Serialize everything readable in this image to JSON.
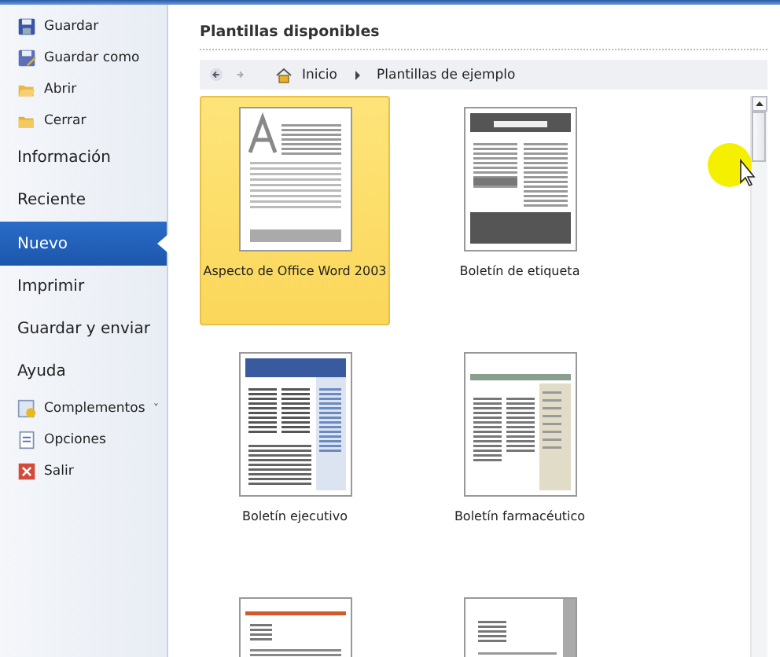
{
  "sidebar": {
    "items": [
      {
        "kind": "command",
        "label": "Guardar",
        "selected": false
      },
      {
        "kind": "command",
        "label": "Guardar como",
        "selected": false
      },
      {
        "kind": "command",
        "label": "Abrir",
        "selected": false
      },
      {
        "kind": "command",
        "label": "Cerrar",
        "selected": false
      },
      {
        "kind": "section",
        "label": "Información",
        "selected": false
      },
      {
        "kind": "section",
        "label": "Reciente",
        "selected": false
      },
      {
        "kind": "section",
        "label": "Nuevo",
        "selected": true
      },
      {
        "kind": "section",
        "label": "Imprimir",
        "selected": false
      },
      {
        "kind": "section",
        "label": "Guardar y enviar",
        "selected": false
      },
      {
        "kind": "section",
        "label": "Ayuda",
        "selected": false
      },
      {
        "kind": "command",
        "label": "Complementos",
        "dropdown": "ˇ",
        "selected": false
      },
      {
        "kind": "command",
        "label": "Opciones",
        "selected": false
      },
      {
        "kind": "command",
        "label": "Salir",
        "selected": false
      }
    ]
  },
  "main": {
    "title": "Plantillas disponibles",
    "breadcrumb": [
      "Inicio",
      "Plantillas de ejemplo"
    ],
    "templates": [
      {
        "kind": "classic",
        "label": "Aspecto de Office Word 2003",
        "selected": true
      },
      {
        "kind": "dark-newsletter",
        "label": "Boletín de etiqueta",
        "selected": false
      },
      {
        "kind": "blue-newsletter",
        "label": "Boletín ejecutivo",
        "selected": false
      },
      {
        "kind": "green-newsletter",
        "label": "Boletín farmacéutico",
        "selected": false
      },
      {
        "kind": "orange-letter",
        "selected": false
      },
      {
        "kind": "plain-letter",
        "selected": false
      }
    ]
  }
}
